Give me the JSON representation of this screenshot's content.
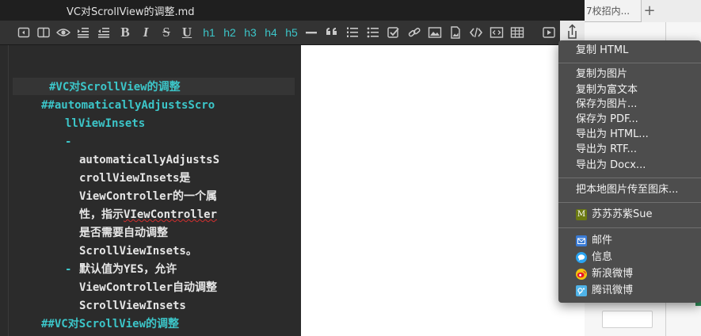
{
  "window": {
    "title": "VC对ScrollView的调整.md"
  },
  "background": {
    "tab_label": "7校招内...",
    "new_tab": "+"
  },
  "toolbar": {
    "bold": "B",
    "italic": "I",
    "strike": "S",
    "underline": "U",
    "h1": "h1",
    "h2": "h2",
    "h3": "h3",
    "h4": "h4",
    "h5": "h5"
  },
  "editor": {
    "lines": [
      "#VC对ScrollView的调整",
      "##automaticallyAdjustsScro",
      "llViewInsets",
      "-",
      "automaticallyAdjustsS",
      "crollViewInsets是",
      "ViewController的一个属",
      "性，指示",
      "VIewController",
      "是否需要自动调整",
      "ScrollViewInsets。",
      "-",
      "默认值为YES，允许",
      "ViewController自动调整",
      "ScrollViewInsets",
      "##VC对ScrollView的调整"
    ]
  },
  "share_menu": {
    "copy_html": "复制 HTML",
    "copy_image": "复制为图片",
    "copy_rich": "复制为富文本",
    "save_image": "保存为图片...",
    "save_pdf": "保存为 PDF...",
    "export_html": "导出为 HTML...",
    "export_rtf": "导出为 RTF...",
    "export_docx": "导出为 Docx...",
    "upload_images": "把本地图片传至图床...",
    "account_badge": "M",
    "account": "苏苏苏紫Sue",
    "mail": "邮件",
    "messages": "信息",
    "weibo": "新浪微博",
    "tencent_weibo": "腾讯微博"
  }
}
